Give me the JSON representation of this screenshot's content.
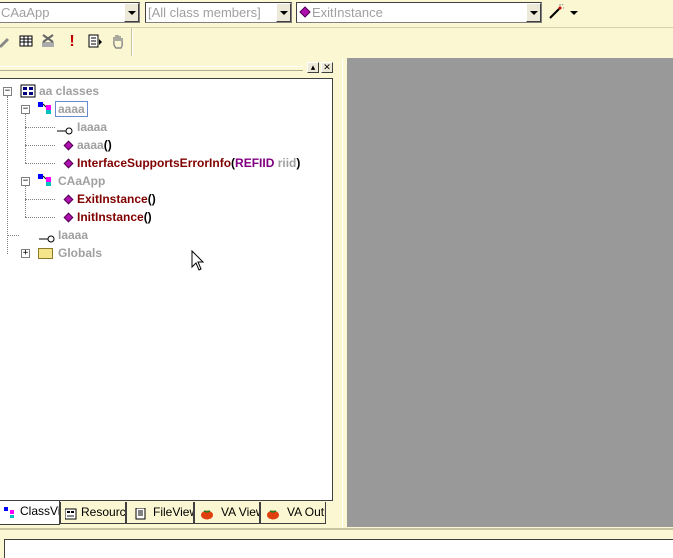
{
  "toolbar": {
    "class_combo": {
      "value": "CAaApp"
    },
    "filter_combo": {
      "value": "[All class members]"
    },
    "member_combo": {
      "value": "ExitInstance"
    },
    "wand_icon": "magic-wand-icon"
  },
  "tree": {
    "root": {
      "label": "aa classes"
    },
    "class1": {
      "label": "aaaa",
      "children": [
        {
          "label": "Iaaaa"
        },
        {
          "label": "aaaa",
          "suffix": "()"
        },
        {
          "label": "InterfaceSupportsErrorInfo",
          "paren_open": "(",
          "param_type": "REFIID",
          "param_name": "riid",
          "paren_close": ")"
        }
      ]
    },
    "class2": {
      "label": "CAaApp",
      "children": [
        {
          "label": "ExitInstance",
          "suffix": "()"
        },
        {
          "label": "InitInstance",
          "suffix": "()"
        }
      ]
    },
    "global_iface": {
      "label": "Iaaaa"
    },
    "globals": {
      "label": "Globals"
    }
  },
  "tabs": [
    {
      "label": "ClassVie"
    },
    {
      "label": "Resourc"
    },
    {
      "label": "FileView"
    },
    {
      "label": "VA View"
    },
    {
      "label": "VA Outl"
    }
  ],
  "colors": {
    "toolbar_bg": "#fbf7d2",
    "mdi_bg": "#999999",
    "member_red": "#800000",
    "param_purple": "#800080"
  }
}
